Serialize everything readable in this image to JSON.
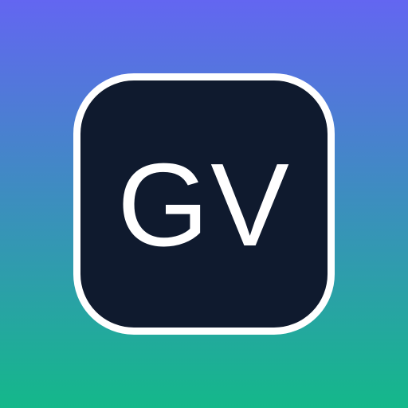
{
  "icon": {
    "monogram": "GV"
  },
  "colors": {
    "background_top": "#6366f1",
    "background_bottom": "#14b88a",
    "tile_fill": "#0f1a2e",
    "tile_border": "#ffffff",
    "monogram_text": "#ffffff"
  }
}
